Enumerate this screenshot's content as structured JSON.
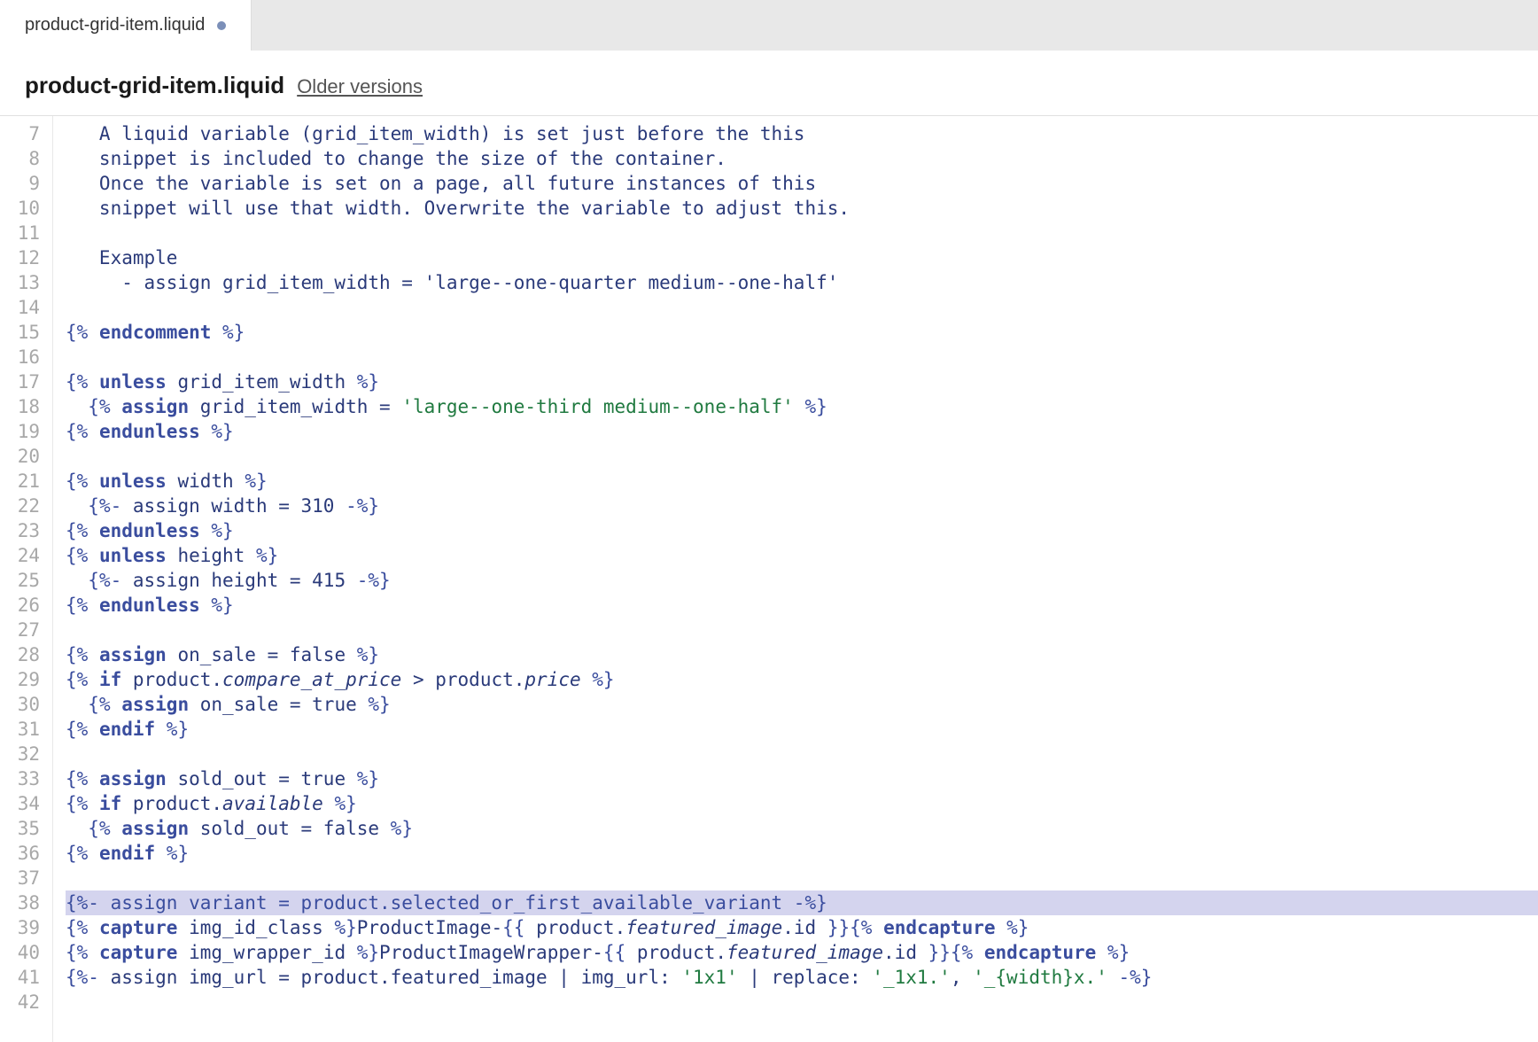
{
  "tab": {
    "label": "product-grid-item.liquid"
  },
  "title": "product-grid-item.liquid",
  "older_versions": "Older versions",
  "gutter_start": 7,
  "gutter_end": 42,
  "code": {
    "l7": "   A liquid variable (grid_item_width) is set just before the this",
    "l8": "   snippet is included to change the size of the container.",
    "l9": "   Once the variable is set on a page, all future instances of this",
    "l10": "   snippet will use that width. Overwrite the variable to adjust this.",
    "l11": "",
    "l12": "   Example",
    "l13": "     - assign grid_item_width = 'large--one-quarter medium--one-half'",
    "l14": "",
    "l15": {
      "open": "{% ",
      "kw": "endcomment",
      "close": " %}"
    },
    "l16": "",
    "l17": {
      "open": "{% ",
      "kw": "unless",
      "rest": " grid_item_width ",
      "close": "%}"
    },
    "l18": {
      "indent": "  ",
      "open": "{% ",
      "kw": "assign",
      "rest": " grid_item_width = ",
      "str": "'large--one-third medium--one-half'",
      "close2": " %}"
    },
    "l19": {
      "open": "{% ",
      "kw": "endunless",
      "close": " %}"
    },
    "l20": "",
    "l21": {
      "open": "{% ",
      "kw": "unless",
      "rest": " width ",
      "close": "%}"
    },
    "l22": {
      "indent": "  ",
      "open": "{%- ",
      "rest": "assign width = 310 ",
      "close": "-%}"
    },
    "l23": {
      "open": "{% ",
      "kw": "endunless",
      "close": " %}"
    },
    "l24": {
      "open": "{% ",
      "kw": "unless",
      "rest": " height ",
      "close": "%}"
    },
    "l25": {
      "indent": "  ",
      "open": "{%- ",
      "rest": "assign height = 415 ",
      "close": "-%}"
    },
    "l26": {
      "open": "{% ",
      "kw": "endunless",
      "close": " %}"
    },
    "l27": "",
    "l28": {
      "open": "{% ",
      "kw": "assign",
      "rest": " on_sale = false ",
      "close": "%}"
    },
    "l29": {
      "open": "{% ",
      "kw": "if",
      "rest1": " product.",
      "it1": "compare_at_price",
      "rest2": " > product.",
      "it2": "price",
      "close2": " %}"
    },
    "l30": {
      "indent": "  ",
      "open": "{% ",
      "kw": "assign",
      "rest": " on_sale = true ",
      "close": "%}"
    },
    "l31": {
      "open": "{% ",
      "kw": "endif",
      "close": " %}"
    },
    "l32": "",
    "l33": {
      "open": "{% ",
      "kw": "assign",
      "rest": " sold_out = true ",
      "close": "%}"
    },
    "l34": {
      "open": "{% ",
      "kw": "if",
      "rest1": " product.",
      "it1": "available",
      "close2": " %}"
    },
    "l35": {
      "indent": "  ",
      "open": "{% ",
      "kw": "assign",
      "rest": " sold_out = false ",
      "close": "%}"
    },
    "l36": {
      "open": "{% ",
      "kw": "endif",
      "close": " %}"
    },
    "l37": "",
    "l38": "{%- assign variant = product.selected_or_first_available_variant -%}",
    "l39": {
      "open": "{% ",
      "kw": "capture",
      "rest1": " img_id_class ",
      "mid": "%}",
      "txt": "ProductImage-",
      "oo": "{{ ",
      "rest2": "product.",
      "it1": "featured_image",
      "rest3": ".id ",
      "cc": "}}",
      "open2": "{% ",
      "kw2": "endcapture",
      "close": " %}"
    },
    "l40": {
      "open": "{% ",
      "kw": "capture",
      "rest1": " img_wrapper_id ",
      "mid": "%}",
      "txt": "ProductImageWrapper-",
      "oo": "{{ ",
      "rest2": "product.",
      "it1": "featured_image",
      "rest3": ".id ",
      "cc": "}}",
      "open2": "{% ",
      "kw2": "endcapture",
      "close": " %}"
    },
    "l41": {
      "open": "{%- ",
      "rest1": "assign img_url = product.featured_image | img_url: ",
      "str1": "'1x1'",
      "rest2": " | replace: ",
      "str2": "'_1x1.'",
      "rest3": ", ",
      "str3": "'_{width}x.'",
      "close": " -%}"
    },
    "l42": ""
  }
}
